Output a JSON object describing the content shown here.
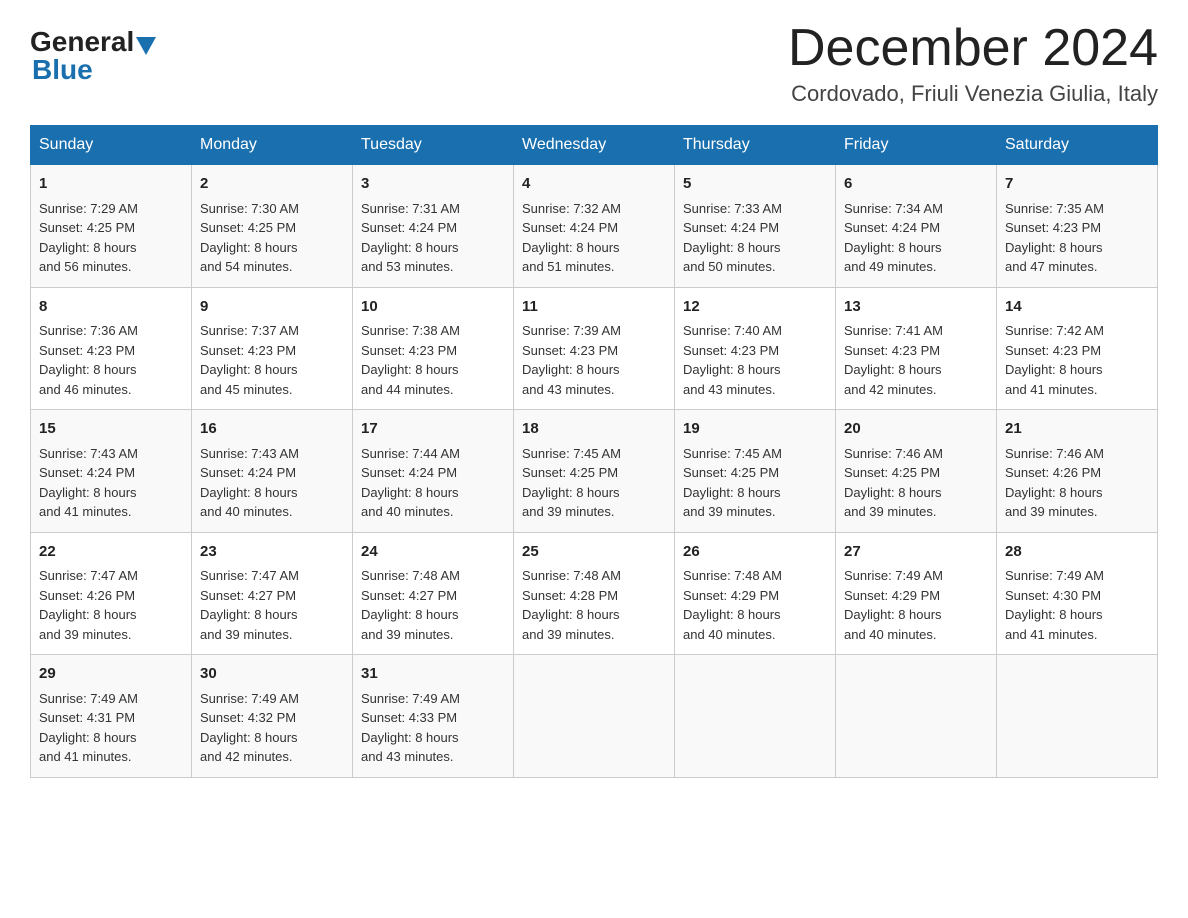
{
  "logo": {
    "general": "General",
    "blue": "Blue"
  },
  "title": "December 2024",
  "subtitle": "Cordovado, Friuli Venezia Giulia, Italy",
  "days_of_week": [
    "Sunday",
    "Monday",
    "Tuesday",
    "Wednesday",
    "Thursday",
    "Friday",
    "Saturday"
  ],
  "weeks": [
    [
      {
        "day": "1",
        "sunrise": "7:29 AM",
        "sunset": "4:25 PM",
        "daylight": "8 hours and 56 minutes."
      },
      {
        "day": "2",
        "sunrise": "7:30 AM",
        "sunset": "4:25 PM",
        "daylight": "8 hours and 54 minutes."
      },
      {
        "day": "3",
        "sunrise": "7:31 AM",
        "sunset": "4:24 PM",
        "daylight": "8 hours and 53 minutes."
      },
      {
        "day": "4",
        "sunrise": "7:32 AM",
        "sunset": "4:24 PM",
        "daylight": "8 hours and 51 minutes."
      },
      {
        "day": "5",
        "sunrise": "7:33 AM",
        "sunset": "4:24 PM",
        "daylight": "8 hours and 50 minutes."
      },
      {
        "day": "6",
        "sunrise": "7:34 AM",
        "sunset": "4:24 PM",
        "daylight": "8 hours and 49 minutes."
      },
      {
        "day": "7",
        "sunrise": "7:35 AM",
        "sunset": "4:23 PM",
        "daylight": "8 hours and 47 minutes."
      }
    ],
    [
      {
        "day": "8",
        "sunrise": "7:36 AM",
        "sunset": "4:23 PM",
        "daylight": "8 hours and 46 minutes."
      },
      {
        "day": "9",
        "sunrise": "7:37 AM",
        "sunset": "4:23 PM",
        "daylight": "8 hours and 45 minutes."
      },
      {
        "day": "10",
        "sunrise": "7:38 AM",
        "sunset": "4:23 PM",
        "daylight": "8 hours and 44 minutes."
      },
      {
        "day": "11",
        "sunrise": "7:39 AM",
        "sunset": "4:23 PM",
        "daylight": "8 hours and 43 minutes."
      },
      {
        "day": "12",
        "sunrise": "7:40 AM",
        "sunset": "4:23 PM",
        "daylight": "8 hours and 43 minutes."
      },
      {
        "day": "13",
        "sunrise": "7:41 AM",
        "sunset": "4:23 PM",
        "daylight": "8 hours and 42 minutes."
      },
      {
        "day": "14",
        "sunrise": "7:42 AM",
        "sunset": "4:23 PM",
        "daylight": "8 hours and 41 minutes."
      }
    ],
    [
      {
        "day": "15",
        "sunrise": "7:43 AM",
        "sunset": "4:24 PM",
        "daylight": "8 hours and 41 minutes."
      },
      {
        "day": "16",
        "sunrise": "7:43 AM",
        "sunset": "4:24 PM",
        "daylight": "8 hours and 40 minutes."
      },
      {
        "day": "17",
        "sunrise": "7:44 AM",
        "sunset": "4:24 PM",
        "daylight": "8 hours and 40 minutes."
      },
      {
        "day": "18",
        "sunrise": "7:45 AM",
        "sunset": "4:25 PM",
        "daylight": "8 hours and 39 minutes."
      },
      {
        "day": "19",
        "sunrise": "7:45 AM",
        "sunset": "4:25 PM",
        "daylight": "8 hours and 39 minutes."
      },
      {
        "day": "20",
        "sunrise": "7:46 AM",
        "sunset": "4:25 PM",
        "daylight": "8 hours and 39 minutes."
      },
      {
        "day": "21",
        "sunrise": "7:46 AM",
        "sunset": "4:26 PM",
        "daylight": "8 hours and 39 minutes."
      }
    ],
    [
      {
        "day": "22",
        "sunrise": "7:47 AM",
        "sunset": "4:26 PM",
        "daylight": "8 hours and 39 minutes."
      },
      {
        "day": "23",
        "sunrise": "7:47 AM",
        "sunset": "4:27 PM",
        "daylight": "8 hours and 39 minutes."
      },
      {
        "day": "24",
        "sunrise": "7:48 AM",
        "sunset": "4:27 PM",
        "daylight": "8 hours and 39 minutes."
      },
      {
        "day": "25",
        "sunrise": "7:48 AM",
        "sunset": "4:28 PM",
        "daylight": "8 hours and 39 minutes."
      },
      {
        "day": "26",
        "sunrise": "7:48 AM",
        "sunset": "4:29 PM",
        "daylight": "8 hours and 40 minutes."
      },
      {
        "day": "27",
        "sunrise": "7:49 AM",
        "sunset": "4:29 PM",
        "daylight": "8 hours and 40 minutes."
      },
      {
        "day": "28",
        "sunrise": "7:49 AM",
        "sunset": "4:30 PM",
        "daylight": "8 hours and 41 minutes."
      }
    ],
    [
      {
        "day": "29",
        "sunrise": "7:49 AM",
        "sunset": "4:31 PM",
        "daylight": "8 hours and 41 minutes."
      },
      {
        "day": "30",
        "sunrise": "7:49 AM",
        "sunset": "4:32 PM",
        "daylight": "8 hours and 42 minutes."
      },
      {
        "day": "31",
        "sunrise": "7:49 AM",
        "sunset": "4:33 PM",
        "daylight": "8 hours and 43 minutes."
      },
      null,
      null,
      null,
      null
    ]
  ],
  "labels": {
    "sunrise": "Sunrise:",
    "sunset": "Sunset:",
    "daylight": "Daylight:"
  }
}
